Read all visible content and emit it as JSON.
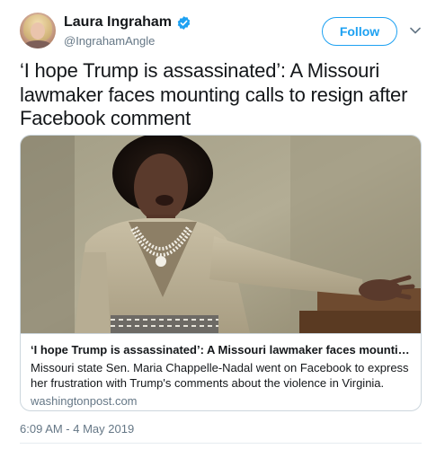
{
  "author": {
    "display_name": "Laura Ingraham",
    "handle": "@IngrahamAngle",
    "verified": true,
    "avatar_icon": "profile-photo"
  },
  "actions": {
    "follow_label": "Follow",
    "more_icon": "chevron-down-icon"
  },
  "tweet": {
    "text": "‘I hope Trump is assassinated’: A Missouri lawmaker faces mounting calls to resign after Facebook comment",
    "timestamp": "6:09 AM - 4 May 2019"
  },
  "card": {
    "title": "‘I hope Trump is assassinated’: A Missouri lawmaker faces mounting calls to …",
    "description": "Missouri state Sen. Maria Chappelle-Nadal went on Facebook to express her frustration with Trump's comments about the violence in Virginia.",
    "domain": "washingtonpost.com",
    "image_icon": "article-photo"
  },
  "colors": {
    "accent": "#1da1f2",
    "secondary_text": "#657786",
    "border": "#ccd6dd"
  }
}
